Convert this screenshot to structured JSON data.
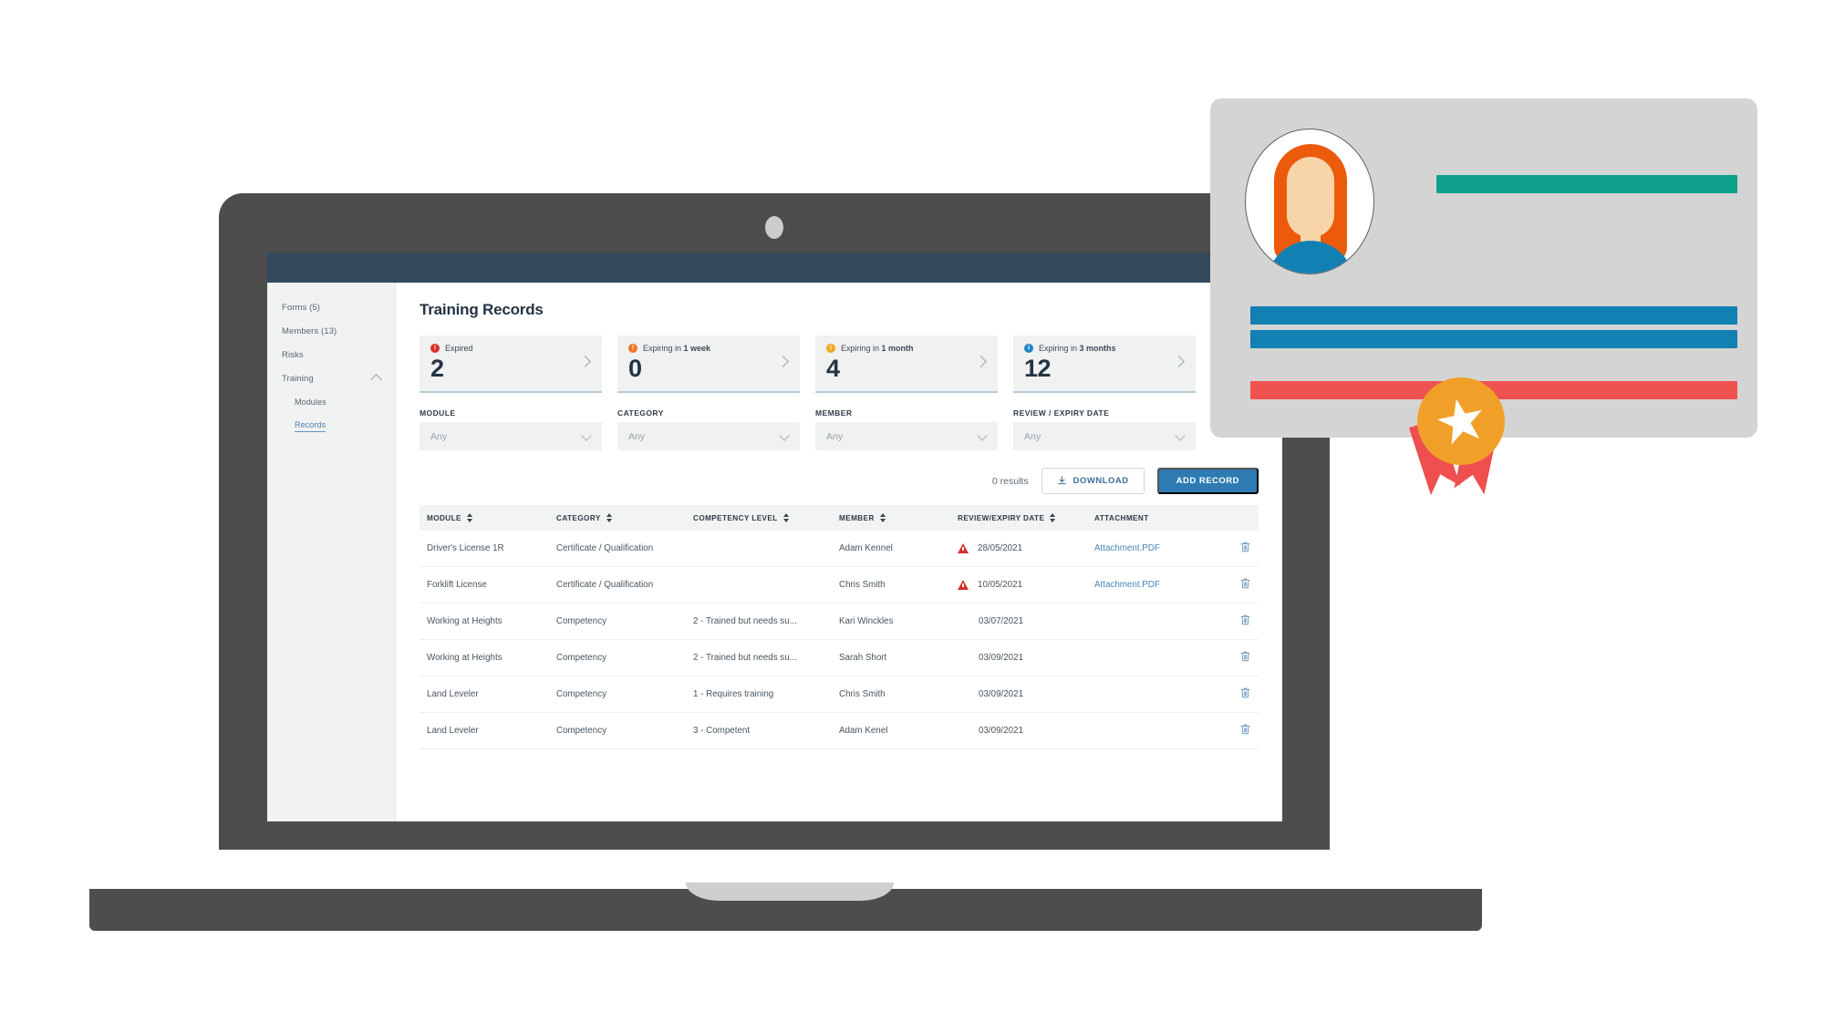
{
  "app": {
    "title": "Training Records"
  },
  "sidebar": {
    "items": [
      {
        "label": "Forms (5)",
        "type": "top",
        "active": false
      },
      {
        "label": "Members (13)",
        "type": "top",
        "active": false
      },
      {
        "label": "Risks",
        "type": "top",
        "active": false
      },
      {
        "label": "Training",
        "type": "top",
        "active": false,
        "expanded": true
      },
      {
        "label": "Modules",
        "type": "sub",
        "active": false
      },
      {
        "label": "Records",
        "type": "sub",
        "active": true
      }
    ]
  },
  "stats": [
    {
      "label_prefix": "Expired",
      "label_bold": "",
      "value": "2",
      "color": "#dc2f26",
      "icon": "alert-circle-icon"
    },
    {
      "label_prefix": "Expiring in ",
      "label_bold": "1 week",
      "value": "0",
      "color": "#ef7622",
      "icon": "alert-circle-icon"
    },
    {
      "label_prefix": "Expiring in ",
      "label_bold": "1 month",
      "value": "4",
      "color": "#f0a81e",
      "icon": "alert-circle-icon"
    },
    {
      "label_prefix": "Expiring in ",
      "label_bold": "3 months",
      "value": "12",
      "color": "#1f85cc",
      "icon": "info-circle-icon"
    }
  ],
  "filters": [
    {
      "label": "MODULE",
      "value": "Any"
    },
    {
      "label": "CATEGORY",
      "value": "Any"
    },
    {
      "label": "MEMBER",
      "value": "Any"
    },
    {
      "label": "REVIEW / EXPIRY DATE",
      "value": "Any"
    }
  ],
  "actions": {
    "results": "0 results",
    "download": "DOWNLOAD",
    "add_record": "ADD RECORD"
  },
  "table": {
    "columns": [
      {
        "label": "MODULE",
        "sortable": true
      },
      {
        "label": "CATEGORY",
        "sortable": true
      },
      {
        "label": "COMPETENCY LEVEL",
        "sortable": true
      },
      {
        "label": "MEMBER",
        "sortable": true
      },
      {
        "label": "REVIEW/EXPIRY DATE",
        "sortable": true
      },
      {
        "label": "ATTACHMENT",
        "sortable": false
      }
    ],
    "rows": [
      {
        "module": "Driver's License 1R",
        "category": "Certificate / Qualification",
        "competency": "",
        "member": "Adam Kennel",
        "date": "28/05/2021",
        "expired": true,
        "attachment": "Attachment.PDF"
      },
      {
        "module": "Forklift License",
        "category": "Certificate / Qualification",
        "competency": "",
        "member": "Chris Smith",
        "date": "10/05/2021",
        "expired": true,
        "attachment": "Attachment.PDF"
      },
      {
        "module": "Working at Heights",
        "category": "Competency",
        "competency": "2 - Trained but needs su...",
        "member": "Kari Winckles",
        "date": "03/07/2021",
        "expired": false,
        "attachment": ""
      },
      {
        "module": "Working at Heights",
        "category": "Competency",
        "competency": "2 - Trained but needs su...",
        "member": "Sarah Short",
        "date": "03/09/2021",
        "expired": false,
        "attachment": ""
      },
      {
        "module": "Land Leveler",
        "category": "Competency",
        "competency": "1 - Requires training",
        "member": "Chris Smith",
        "date": "03/09/2021",
        "expired": false,
        "attachment": ""
      },
      {
        "module": "Land Leveler",
        "category": "Competency",
        "competency": "3 - Competent",
        "member": "Adam Kenel",
        "date": "03/09/2021",
        "expired": false,
        "attachment": ""
      }
    ]
  },
  "colors": {
    "accent_blue": "#2d7bb0",
    "topbar": "#34495b",
    "laptop": "#4d4d4d",
    "card_teal": "#0fa08c",
    "card_blue": "#1380b4",
    "card_red": "#ef5350",
    "medal_orange": "#f0a028",
    "ribbon_red": "#ef4f4f",
    "expired_red": "#d13228"
  }
}
